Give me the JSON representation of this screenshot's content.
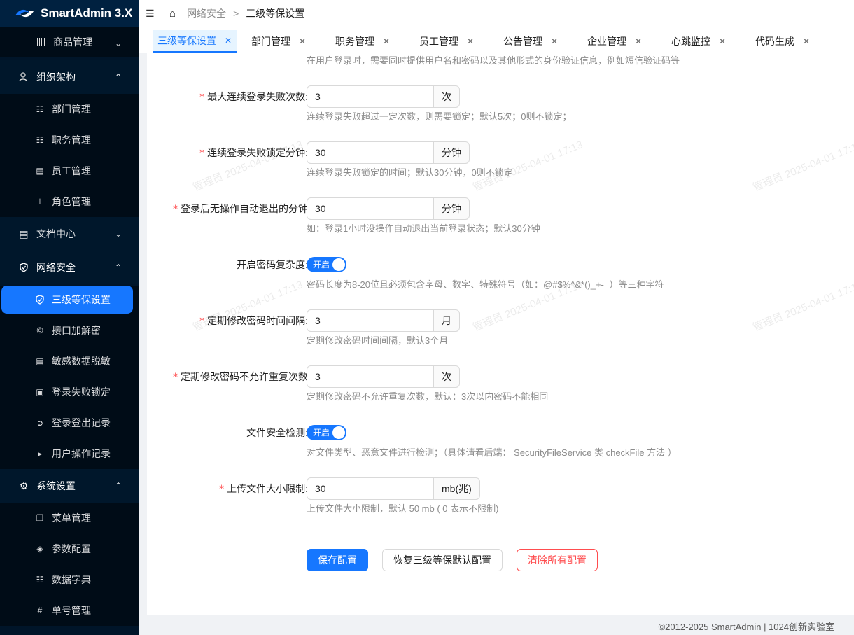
{
  "app": {
    "title": "SmartAdmin 3.X"
  },
  "sidebar": {
    "top_item": {
      "label": "商品管理",
      "icon": "barcode-icon"
    },
    "groups": [
      {
        "label": "组织架构",
        "icon": "org-icon",
        "expanded": true,
        "items": [
          {
            "label": "部门管理",
            "icon": "tree-icon"
          },
          {
            "label": "职务管理",
            "icon": "tree-icon"
          },
          {
            "label": "员工管理",
            "icon": "doc-search-icon"
          },
          {
            "label": "角色管理",
            "icon": "role-icon"
          }
        ]
      },
      {
        "label": "文档中心",
        "icon": "doc-search-icon",
        "expanded": false,
        "items": []
      },
      {
        "label": "网络安全",
        "icon": "shield-icon",
        "expanded": true,
        "items": [
          {
            "label": "三级等保设置",
            "icon": "shield-icon",
            "selected": true
          },
          {
            "label": "接口加解密",
            "icon": "copyright-icon"
          },
          {
            "label": "敏感数据脱敏",
            "icon": "doc-search-icon"
          },
          {
            "label": "登录失败锁定",
            "icon": "lock-icon"
          },
          {
            "label": "登录登出记录",
            "icon": "login-icon"
          },
          {
            "label": "用户操作记录",
            "icon": "video-icon"
          }
        ]
      },
      {
        "label": "系统设置",
        "icon": "gear-icon",
        "expanded": true,
        "items": [
          {
            "label": "菜单管理",
            "icon": "copy-icon"
          },
          {
            "label": "参数配置",
            "icon": "diamond-icon"
          },
          {
            "label": "数据字典",
            "icon": "barcode-icon"
          },
          {
            "label": "单号管理",
            "icon": "number-icon"
          }
        ]
      }
    ]
  },
  "header": {
    "breadcrumb": [
      "网络安全",
      "三级等保设置"
    ],
    "breadcrumb_sep": ">"
  },
  "tabs": [
    {
      "label": "三级等保设置",
      "active": true
    },
    {
      "label": "部门管理"
    },
    {
      "label": "职务管理"
    },
    {
      "label": "员工管理"
    },
    {
      "label": "公告管理"
    },
    {
      "label": "企业管理"
    },
    {
      "label": "心跳监控"
    },
    {
      "label": "代码生成"
    }
  ],
  "form": {
    "top_help": "在用户登录时，需要同时提供用户名和密码以及其他形式的身份验证信息，例如短信验证码等",
    "fields": [
      {
        "label": "最大连续登录失败次数:",
        "required": true,
        "value": "3",
        "unit": "次",
        "help": "连续登录失败超过一定次数，则需要锁定；默认5次；0则不锁定；"
      },
      {
        "label": "连续登录失败锁定分钟:",
        "required": true,
        "value": "30",
        "unit": "分钟",
        "help": "连续登录失败锁定的时间；默认30分钟，0则不锁定"
      },
      {
        "label": "登录后无操作自动退出的分钟",
        "required": true,
        "value": "30",
        "unit": "分钟",
        "help": "如：登录1小时没操作自动退出当前登录状态；默认30分钟"
      },
      {
        "label": "开启密码复杂度:",
        "required": false,
        "switch": "开启",
        "help": "密码长度为8-20位且必须包含字母、数字、特殊符号（如：@#$%^&*()_+-=）等三种字符"
      },
      {
        "label": "定期修改密码时间间隔:",
        "required": true,
        "value": "3",
        "unit": "月",
        "help": "定期修改密码时间间隔，默认3个月"
      },
      {
        "label": "定期修改密码不允许重复次数",
        "required": true,
        "value": "3",
        "unit": "次",
        "help": "定期修改密码不允许重复次数，默认：3次以内密码不能相同"
      },
      {
        "label": "文件安全检测:",
        "required": false,
        "switch": "开启",
        "help": "对文件类型、恶意文件进行检测；（具体请看后端： SecurityFileService 类 checkFile 方法 ）"
      },
      {
        "label": "上传文件大小限制:",
        "required": true,
        "value": "30",
        "unit": "mb(兆)",
        "help": "上传文件大小限制，默认 50 mb ( 0 表示不限制)"
      }
    ],
    "buttons": {
      "save": "保存配置",
      "restore": "恢复三级等保默认配置",
      "clear": "清除所有配置"
    }
  },
  "watermark": {
    "text": "管理员 2025-04-01 17:13"
  },
  "footer": {
    "text": "©2012-2025 SmartAdmin | 1024创新实验室"
  },
  "colors": {
    "primary": "#1677ff",
    "danger": "#ff4d4f",
    "sidebar_bg": "#001529"
  }
}
